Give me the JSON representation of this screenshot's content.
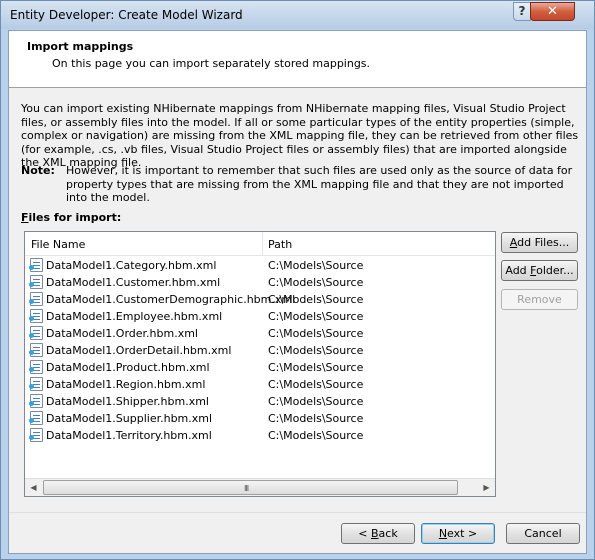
{
  "window": {
    "title": "Entity Developer: Create Model Wizard",
    "help_glyph": "?",
    "close_glyph": "✕"
  },
  "header": {
    "title": "Import mappings",
    "subtitle": "On this page you can import separately stored mappings."
  },
  "description": "You can import existing NHibernate mappings from NHibernate mapping files, Visual Studio Project files, or assembly files into the model. If all or some particular types of the entity properties (simple, complex or navigation) are missing from the XML mapping file, they can be retrieved from other files (for example, .cs, .vb files, Visual Studio Project files or assembly files) that are imported alongside the XML mapping file.",
  "note": {
    "label": "Note:",
    "text": "However, it is important to remember that such files are used only as the source of data for property types that are missing from the XML mapping file and that they are not imported into the model."
  },
  "files": {
    "label_accel": "F",
    "label_rest": "iles for import:",
    "columns": {
      "name": "File Name",
      "path": "Path"
    },
    "rows": [
      {
        "name": "DataModel1.Category.hbm.xml",
        "path": "C:\\Models\\Source"
      },
      {
        "name": "DataModel1.Customer.hbm.xml",
        "path": "C:\\Models\\Source"
      },
      {
        "name": "DataModel1.CustomerDemographic.hbm.xml",
        "path": "C:\\Models\\Source"
      },
      {
        "name": "DataModel1.Employee.hbm.xml",
        "path": "C:\\Models\\Source"
      },
      {
        "name": "DataModel1.Order.hbm.xml",
        "path": "C:\\Models\\Source"
      },
      {
        "name": "DataModel1.OrderDetail.hbm.xml",
        "path": "C:\\Models\\Source"
      },
      {
        "name": "DataModel1.Product.hbm.xml",
        "path": "C:\\Models\\Source"
      },
      {
        "name": "DataModel1.Region.hbm.xml",
        "path": "C:\\Models\\Source"
      },
      {
        "name": "DataModel1.Shipper.hbm.xml",
        "path": "C:\\Models\\Source"
      },
      {
        "name": "DataModel1.Supplier.hbm.xml",
        "path": "C:\\Models\\Source"
      },
      {
        "name": "DataModel1.Territory.hbm.xml",
        "path": "C:\\Models\\Source"
      }
    ],
    "scroll": {
      "left": "◀",
      "right": "▶",
      "grip": "III"
    }
  },
  "side_buttons": {
    "add_files": {
      "accel": "A",
      "rest": "dd Files..."
    },
    "add_folder": {
      "pre": "Add ",
      "accel": "F",
      "rest": "older..."
    },
    "remove": "Remove"
  },
  "nav": {
    "back": {
      "pre": "< ",
      "accel": "B",
      "rest": "ack"
    },
    "next": {
      "accel": "N",
      "rest": "ext >"
    },
    "cancel": "Cancel"
  }
}
